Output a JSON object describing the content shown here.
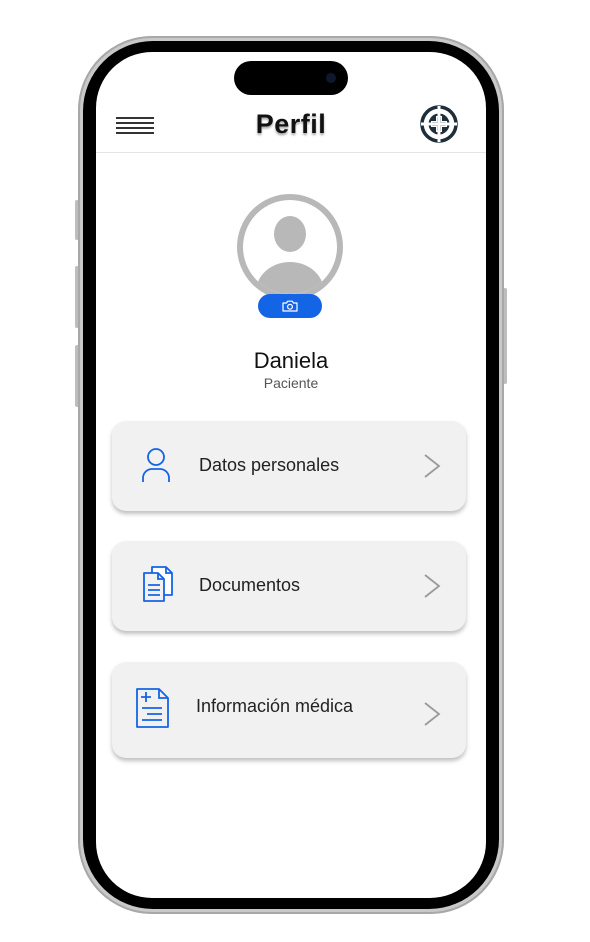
{
  "header": {
    "title": "Perfil",
    "menu_icon": "hamburger-menu-icon",
    "logo_icon": "medical-cross-logo-icon"
  },
  "profile": {
    "name": "Daniela",
    "role": "Paciente",
    "avatar_icon": "user-avatar-placeholder-icon",
    "camera_icon": "camera-icon"
  },
  "menu": [
    {
      "label": "Datos personales",
      "icon": "person-icon"
    },
    {
      "label": "Documentos",
      "icon": "documents-icon"
    },
    {
      "label": "Información médica",
      "icon": "medical-record-icon"
    }
  ],
  "colors": {
    "accent": "#1464e6",
    "card_bg": "#f1f1f1",
    "avatar_gray": "#b8b8b8",
    "chevron": "#9a9a9a"
  }
}
